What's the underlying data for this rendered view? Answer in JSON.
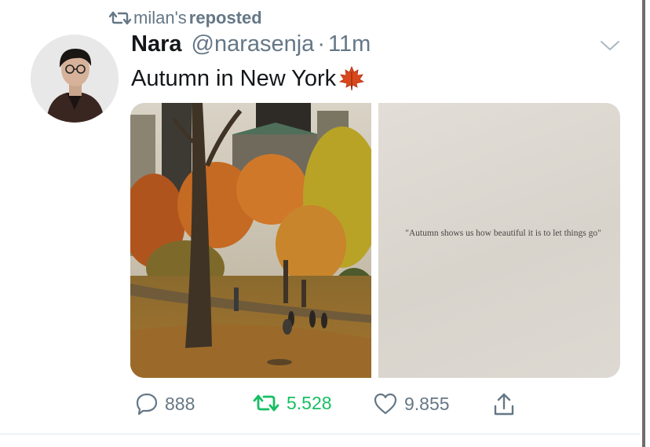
{
  "repost": {
    "user": "milan's",
    "action": "reposted",
    "icon": "retweet-icon"
  },
  "tweet": {
    "display_name": "Nara",
    "handle": "@narasenja",
    "separator": "·",
    "time": "11m",
    "text": "Autumn in New York",
    "emoji_icon": "maple-leaf-icon"
  },
  "media": {
    "left_photo": "central-park-autumn-photo",
    "right_quote": "\"Autumn shows us how beautiful it is to let things go\""
  },
  "actions": {
    "replies": "888",
    "retweets": "5.528",
    "likes": "9.855"
  },
  "colors": {
    "muted": "#657786",
    "retweet_green": "#17bf63",
    "text": "#14171a"
  }
}
